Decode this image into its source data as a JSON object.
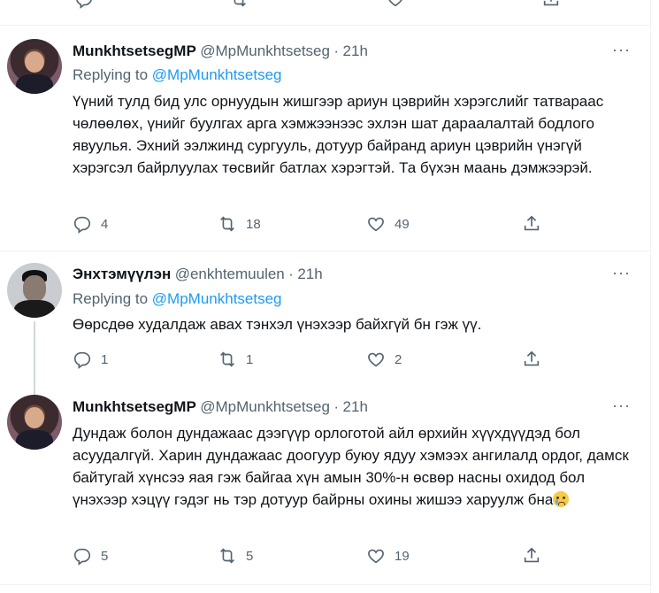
{
  "colors": {
    "link": "#1d9bf0",
    "muted": "#536471",
    "text": "#0f1419",
    "divider": "#eff3f4"
  },
  "tweets": [
    {
      "author": "MunkhtsetsegMP",
      "handle": "@MpMunkhtsetseg",
      "time": "21h",
      "separator": "·",
      "replying_label": "Replying to",
      "replying_handle": "@MpMunkhtsetseg",
      "text": "Үүний тулд бид улс орнуудын жишгээр ариун цэврийн хэрэгслийг татвараас чөлөөлөх, үнийг буулгах арга хэмжээнээс эхлэн шат дараалалтай бодлого явуулья. Эхний ээлжинд сургууль, дотуур байранд ариун цэврийн үнэгүй хэрэгсэл байрлуулах төсвийг батлах хэрэгтэй. Та бүхэн маань дэмжээрэй.",
      "replies": "4",
      "retweets": "18",
      "likes": "49"
    },
    {
      "author": "Энхтэмүүлэн",
      "handle": "@enkhtemuulen",
      "time": "21h",
      "separator": "·",
      "replying_label": "Replying to",
      "replying_handle": "@MpMunkhtsetseg",
      "text": "Өөрсдөө худалдаж авах тэнхэл үнэхээр байхгүй бн гэж үү.",
      "replies": "1",
      "retweets": "1",
      "likes": "2"
    },
    {
      "author": "MunkhtsetsegMP",
      "handle": "@MpMunkhtsetseg",
      "time": "21h",
      "separator": "·",
      "text": "Дундаж болон дундажаас дээгүүр орлоготой айл өрхийн хүүхдүүдэд бол асуудалгүй. Харин дундажаас доогуур буюу ядуу хэмээх ангилалд ордог, дамск байтугай хүнсээ яая гэж байгаа хүн амын 30%-н өсвөр насны охидод бол үнэхээр хэцүү гэдэг нь тэр дотуур байрны охины жишээ харуулж бна",
      "emoji": "crying-face-emoji",
      "replies": "5",
      "retweets": "5",
      "likes": "19"
    }
  ],
  "icons": {
    "reply": "reply-icon",
    "retweet": "retweet-icon",
    "like": "heart-icon",
    "share": "share-icon",
    "more": "more-dots-icon"
  }
}
